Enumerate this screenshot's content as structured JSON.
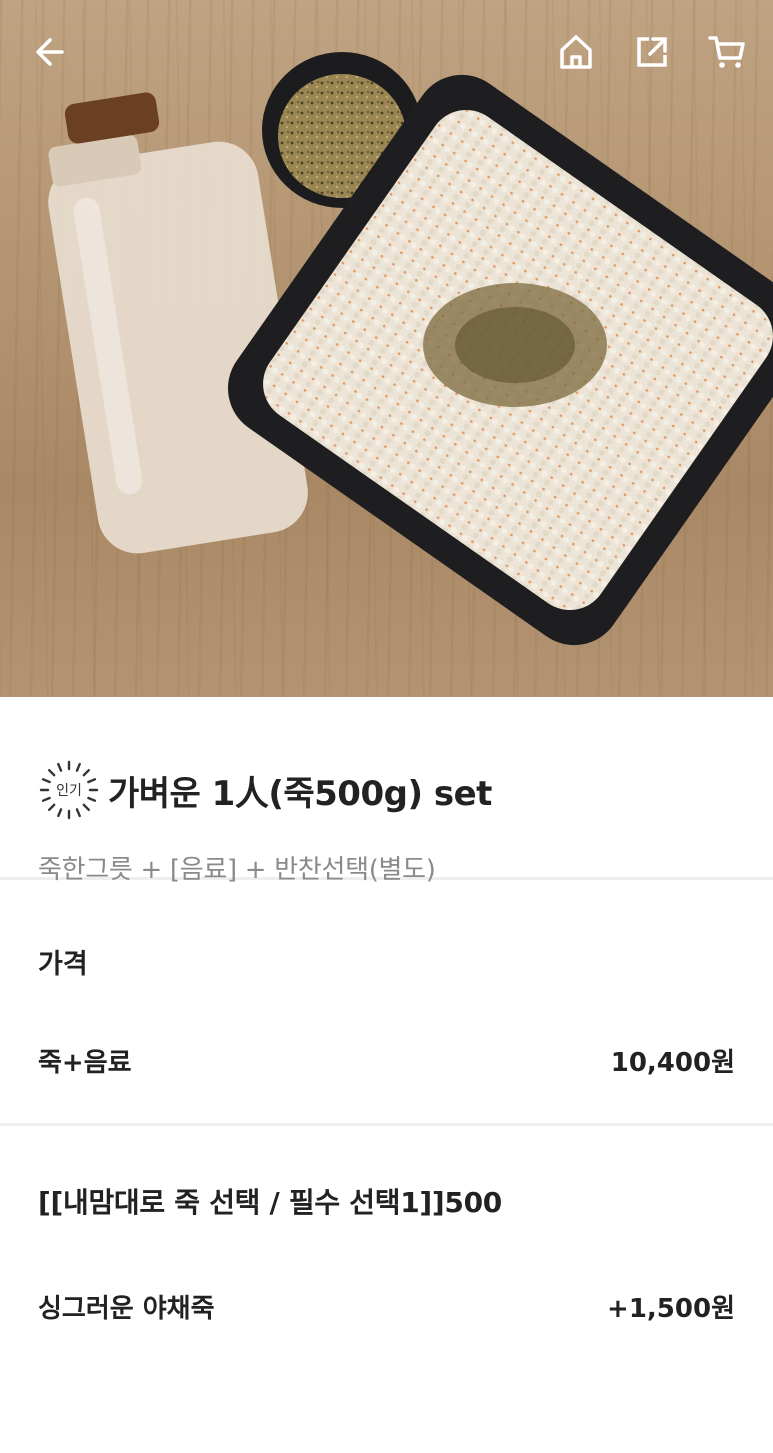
{
  "product": {
    "badge": "인기",
    "title": "가벼운 1人(죽500g) set",
    "subtitle": "죽한그릇 + [음료] + 반찬선택(별도)"
  },
  "price": {
    "label": "가격",
    "item_name": "죽+음료",
    "item_price": "10,400원"
  },
  "option_group": {
    "title": "[[내맘대로 죽 선택 / 필수 선택1]]500",
    "option_name": "싱그러운 야채죽",
    "option_price": "+1,500원"
  },
  "icons": {
    "back": "arrow-left-icon",
    "home": "home-icon",
    "share": "share-icon",
    "cart": "cart-icon"
  },
  "colors": {
    "text": "#222222",
    "subtext": "#8a8a8a",
    "divider": "#eeeeee"
  }
}
